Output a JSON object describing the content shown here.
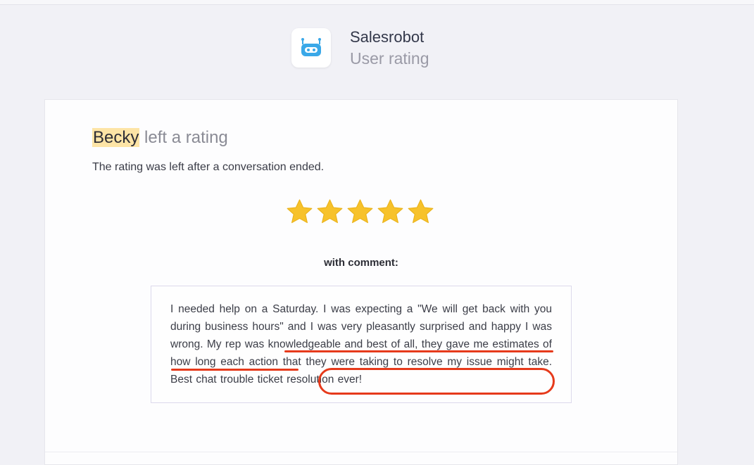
{
  "header": {
    "app_name": "Salesrobot",
    "subtitle": "User rating",
    "icon": "robot-icon"
  },
  "rating": {
    "user_name": "Becky",
    "title_suffix": " left a rating",
    "description": "The rating was left after a conversation ended.",
    "stars": 5,
    "max_stars": 5,
    "comment_label": "with comment:",
    "comment": "I needed help on a Saturday. I was expecting a \"We will get back with you during business hours\" and I was very pleasantly surprised and happy I was wrong. My rep was knowledgeable and best of all, they gave me estimates of how long each action that they were taking to resolve my issue might take. Best chat trouble ticket resolution ever!"
  },
  "colors": {
    "star": "#f7c22b",
    "highlight": "#fde4a6",
    "annotation": "#e63a1b",
    "icon_blue": "#3aa8e8"
  }
}
